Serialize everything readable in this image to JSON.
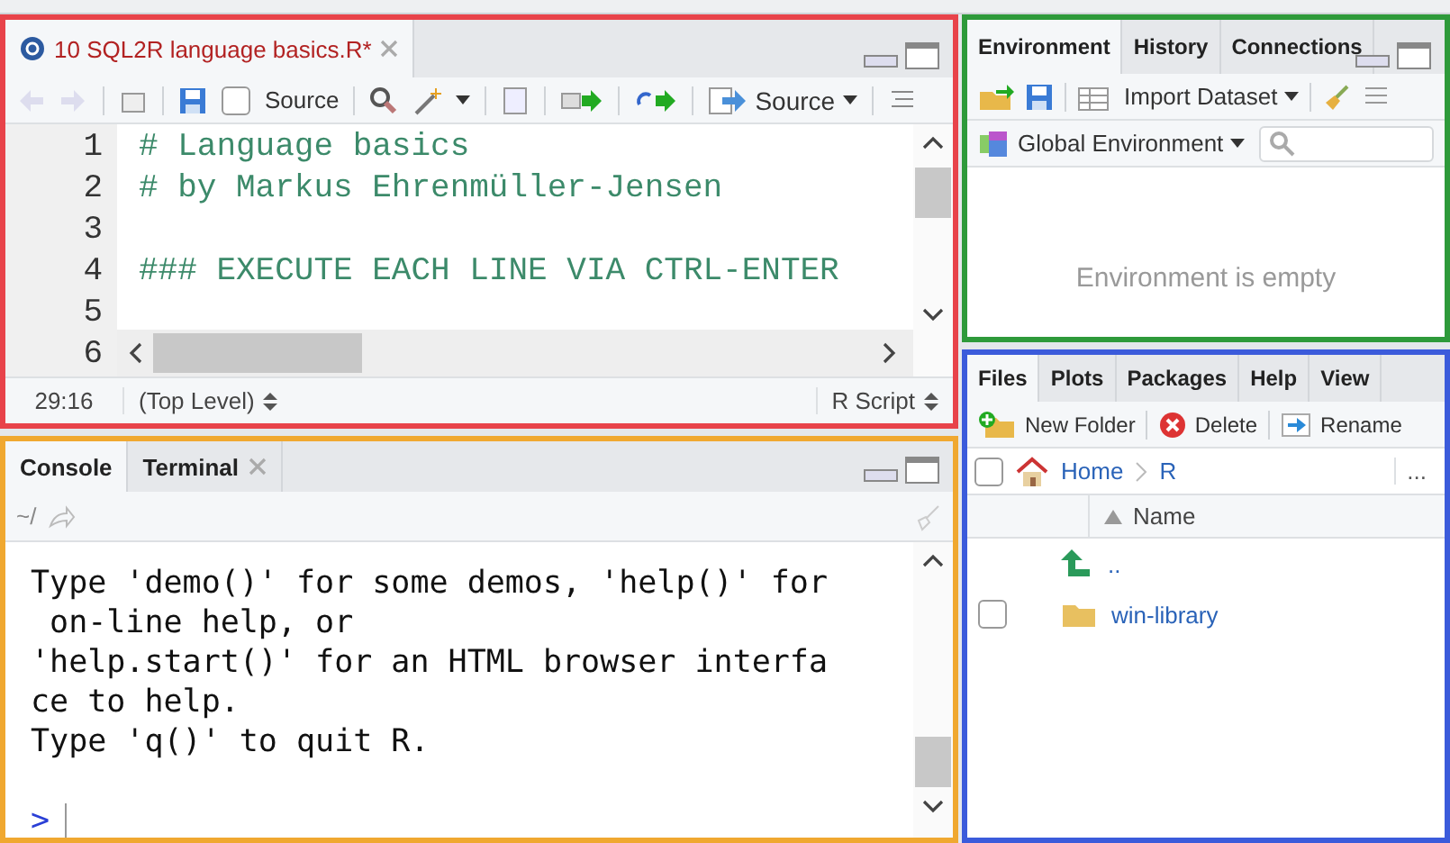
{
  "editor": {
    "tabs": [
      {
        "label": "10 SQL2R language basics.R*",
        "selected": true,
        "modified": true
      }
    ],
    "toolbar": {
      "source_on_save": {
        "label": "Source",
        "checked": false
      },
      "source_button": "Source"
    },
    "lines": [
      {
        "number": "1",
        "text": "# Language basics"
      },
      {
        "number": "2",
        "text": "# by Markus Ehrenmüller-Jensen"
      },
      {
        "number": "3"
      },
      {
        "number": "4",
        "text": "### EXECUTE EACH LINE VIA CTRL-ENTER"
      },
      {
        "number": "5"
      },
      {
        "number": "6"
      }
    ],
    "status": {
      "position": "29:16",
      "scope": "(Top Level)",
      "filetype": "R Script"
    }
  },
  "console": {
    "tabs": [
      {
        "label": "Console",
        "selected": true,
        "closable": false
      },
      {
        "label": "Terminal",
        "selected": false,
        "closable": true
      }
    ],
    "path": "~/",
    "output": [
      "Type 'demo()' for some demos, 'help()' for",
      " on-line help, or",
      "'help.start()' for an HTML browser interfa",
      "ce to help.",
      "Type 'q()' to quit R."
    ],
    "prompt": ">"
  },
  "environment": {
    "tabs": [
      {
        "label": "Environment",
        "selected": true
      },
      {
        "label": "History",
        "selected": false
      },
      {
        "label": "Connections",
        "selected": false
      }
    ],
    "import_label": "Import Dataset",
    "scope": "Global Environment",
    "empty_message": "Environment is empty"
  },
  "files": {
    "tabs": [
      {
        "label": "Files",
        "selected": true
      },
      {
        "label": "Plots",
        "selected": false
      },
      {
        "label": "Packages",
        "selected": false
      },
      {
        "label": "Help",
        "selected": false
      },
      {
        "label": "View",
        "selected": false
      }
    ],
    "actions": [
      "New Folder",
      "Delete",
      "Rename"
    ],
    "select_all_checked": false,
    "breadcrumb": [
      "Home",
      "R"
    ],
    "more": "...",
    "column": "Name",
    "rows": [
      {
        "kind": "parent",
        "name": ".."
      },
      {
        "kind": "folder",
        "name": "win-library",
        "checked": false
      }
    ]
  }
}
